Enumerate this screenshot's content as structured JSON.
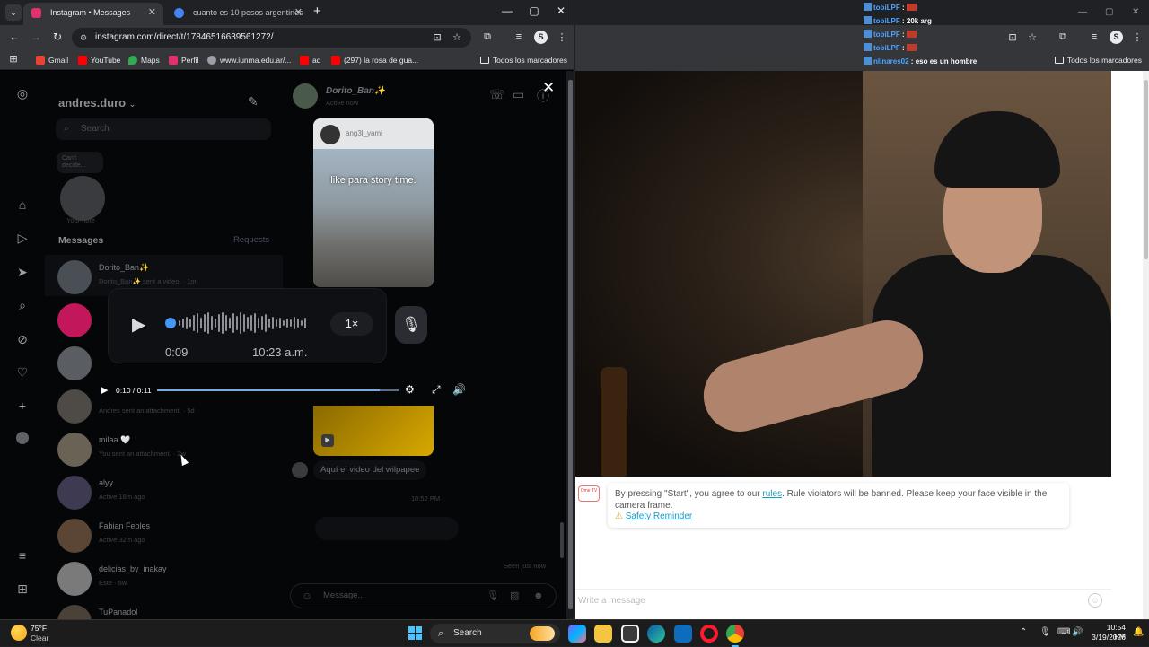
{
  "left_browser": {
    "tabs": [
      {
        "title": "Instagram • Messages",
        "active": true,
        "favicon_color": "#e1306c"
      },
      {
        "title": "cuanto es 10 pesos argentinos",
        "active": false,
        "favicon_color": "#4285f4"
      }
    ],
    "url_prefix": "instagram.com/direct/t/17846516639561272/",
    "bookmarks": [
      {
        "label": "Gmail",
        "color": "#ea4335"
      },
      {
        "label": "YouTube",
        "color": "#ff0000"
      },
      {
        "label": "Maps",
        "color": "#34a853"
      },
      {
        "label": "Perfil",
        "color": "#e1306c"
      },
      {
        "label": "www.iunma.edu.ar/...",
        "color": "#9aa0a6"
      },
      {
        "label": "ad",
        "color": "#ff0000"
      },
      {
        "label": "(297) la rosa de gua...",
        "color": "#ff0000"
      }
    ],
    "all_bookmarks": "Todos los marcadores"
  },
  "instagram": {
    "account": "andres.duro",
    "search_placeholder": "Search",
    "note_bubble": "Can't decide...",
    "note_label": "Your note",
    "messages_heading": "Messages",
    "requests_label": "Requests",
    "conversations": [
      {
        "name": "Dorito_Ban✨",
        "sub": "Dorito_Ban✨ sent a video. · 1m",
        "color": "#4a4e55",
        "selected": true
      },
      {
        "name": "",
        "sub": "",
        "color": "#c2185b",
        "selected": false
      },
      {
        "name": "",
        "sub": "",
        "color": "#5a5d61",
        "selected": false
      },
      {
        "name": "",
        "sub": "Andres sent an attachment. · 5d",
        "color": "#4e4b47",
        "selected": false
      },
      {
        "name": "milaa 🤍",
        "sub": "You sent an attachment. · 2w",
        "color": "#6b6256",
        "selected": false
      },
      {
        "name": "alyy.",
        "sub": "Active 18m ago",
        "color": "#3d3a52",
        "selected": false
      },
      {
        "name": "Fabian Febles",
        "sub": "Active 32m ago",
        "color": "#5b4636",
        "selected": false
      },
      {
        "name": "delicias_by_inakay",
        "sub": "Este · 5w",
        "color": "#7a7a7a",
        "selected": false
      },
      {
        "name": "TuPanadol",
        "sub": "",
        "color": "#4a4238",
        "selected": false
      }
    ],
    "thread": {
      "name": "Dorito_Ban✨",
      "status": "Active now",
      "story_user": "ang3l_yami",
      "story_text": "like para story time.",
      "caption": "Aquí el video del wilpapee",
      "timestamp": "10:52 PM",
      "seen": "Seen just now",
      "composer_placeholder": "Message..."
    },
    "voice_note": {
      "current": "0:09",
      "sent_time": "10:23 a.m.",
      "speed": "1×",
      "progress": 0.0
    },
    "video_player": {
      "time": "0:10 / 0:11",
      "progress": 0.92
    }
  },
  "right_browser": {
    "chat": [
      {
        "user": "tobiLPF",
        "msg": "",
        "flag": true
      },
      {
        "user": "tobiLPF",
        "msg": "20k arg",
        "flag": false
      },
      {
        "user": "tobiLPF",
        "msg": "",
        "flag": true
      },
      {
        "user": "tobiLPF",
        "msg": "",
        "flag": true
      },
      {
        "user": "nlinares02",
        "msg": "eso es un hombre",
        "flag": false
      }
    ],
    "all_bookmarks": "Todos los marcadores",
    "notice_prefix": "By pressing \"Start\", you agree to our ",
    "notice_link": "rules",
    "notice_suffix": ". Rule violators will be banned. Please keep your face visible in the camera frame.",
    "safety_link": "Safety Reminder",
    "logo_text": "Ome TV",
    "message_placeholder": "Write a message"
  },
  "taskbar": {
    "temperature": "75°F",
    "condition": "Clear",
    "search_label": "Search",
    "time": "10:54 PM",
    "date": "3/19/2026"
  }
}
